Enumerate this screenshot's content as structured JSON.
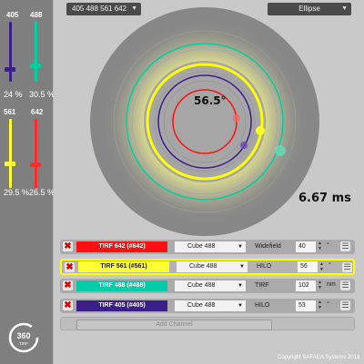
{
  "sliders": [
    {
      "label": "405",
      "value": "24 %",
      "color": "#3a1e8a",
      "level": 0.24
    },
    {
      "label": "488",
      "value": "30.5 %",
      "color": "#00d0a0",
      "level": 0.305
    },
    {
      "label": "561",
      "value": "29.5 %",
      "color": "#ffff33",
      "level": 0.295
    },
    {
      "label": "642",
      "value": "26.5 %",
      "color": "#ff2a2a",
      "level": 0.265
    }
  ],
  "header": {
    "preset_dropdown": "405 488 561 642",
    "shape_dropdown": "Ellipse"
  },
  "display": {
    "angle": "56.5°",
    "time": "6.67 ms"
  },
  "channels": [
    {
      "name": "TIRF 642  (#642)",
      "color": "#ff1010",
      "text_color": "#ffffff",
      "cube": "Cube 488",
      "mode": "Widefield",
      "value": "40",
      "unit": "°"
    },
    {
      "name": "TIRF 561  (#561)",
      "color": "#ffff33",
      "text_color": "#222222",
      "cube": "Cube 488",
      "mode": "HILO",
      "value": "56",
      "unit": "°"
    },
    {
      "name": "TIRF 488  (#488)",
      "color": "#00ccaa",
      "text_color": "#ffffff",
      "cube": "Cube 488",
      "mode": "TIRF",
      "value": "102",
      "unit": "nm"
    },
    {
      "name": "TIRF 405  (#405)",
      "color": "#3a1e8a",
      "text_color": "#ffffff",
      "cube": "Cube 488",
      "mode": "HILO",
      "value": "53",
      "unit": "°"
    }
  ],
  "add_channel": "Add Channel",
  "copyright": "Copyright SAFACA Systems 2018",
  "icons": {
    "close": "close-icon",
    "menu": "menu-icon",
    "dropdown": "chevron-down-icon",
    "logo": "360-tirf-logo"
  }
}
